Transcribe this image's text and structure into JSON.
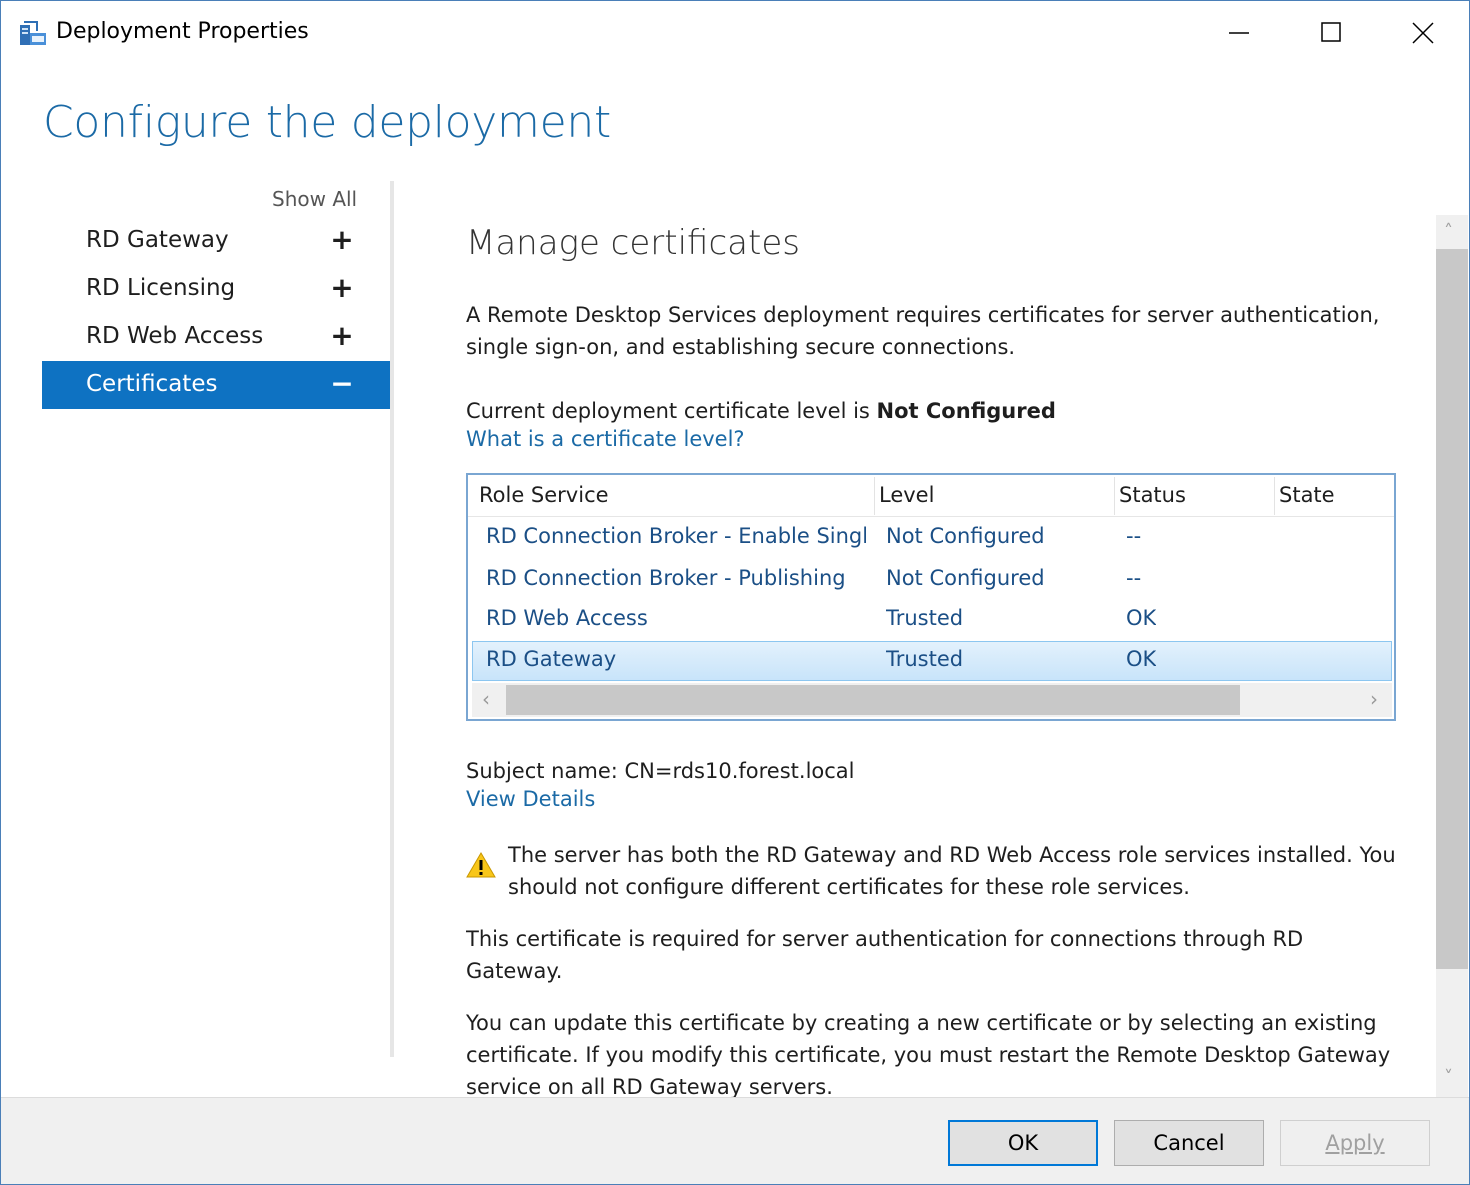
{
  "window": {
    "title": "Deployment Properties",
    "page_title": "Configure the deployment"
  },
  "nav": {
    "show_all": "Show All",
    "items": [
      {
        "label": "RD Gateway",
        "sign": "+"
      },
      {
        "label": "RD Licensing",
        "sign": "+"
      },
      {
        "label": "RD Web Access",
        "sign": "+"
      },
      {
        "label": "Certificates",
        "sign": "−"
      }
    ]
  },
  "content": {
    "section_title": "Manage certificates",
    "intro": "A Remote Desktop Services deployment requires certificates for server authentication, single sign-on, and establishing secure connections.",
    "level_prefix": "Current deployment certificate level is ",
    "level_value": "Not Configured",
    "level_link": "What is a certificate level?",
    "grid": {
      "columns": [
        "Role Service",
        "Level",
        "Status",
        "State"
      ],
      "rows": [
        {
          "role": "RD Connection Broker - Enable Single Sign On",
          "level": "Not Configured",
          "status": "--",
          "state": ""
        },
        {
          "role": "RD Connection Broker - Publishing",
          "level": "Not Configured",
          "status": "--",
          "state": ""
        },
        {
          "role": "RD Web Access",
          "level": "Trusted",
          "status": "OK",
          "state": ""
        },
        {
          "role": "RD Gateway",
          "level": "Trusted",
          "status": "OK",
          "state": ""
        }
      ]
    },
    "subject_name": "Subject name: CN=rds10.forest.local",
    "view_details": "View Details",
    "warning": "The server has both the RD Gateway and RD Web Access role services installed. You should not configure different certificates for these role services.",
    "required_text": "This certificate is required for server authentication for connections through RD Gateway.",
    "update_text": "You can update this certificate by creating a new certificate or by selecting an existing certificate. If you modify this certificate, you must restart the Remote Desktop Gateway service on all RD Gateway servers."
  },
  "footer": {
    "ok": "OK",
    "cancel": "Cancel",
    "apply": "Apply"
  }
}
